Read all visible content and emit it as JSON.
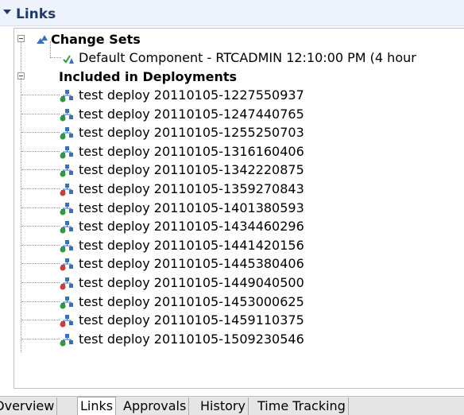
{
  "section": {
    "title": "Links"
  },
  "tree": {
    "change_sets": {
      "label": "Change Sets",
      "items": [
        "Default Component - RTCADMIN 12:10:00 PM (4 hour"
      ]
    },
    "deployments": {
      "label": "Included in Deployments",
      "items": [
        {
          "label": "test deploy 20110105-1227550937",
          "status": "ok"
        },
        {
          "label": "test deploy 20110105-1247440765",
          "status": "ok"
        },
        {
          "label": "test deploy 20110105-1255250703",
          "status": "ok"
        },
        {
          "label": "test deploy 20110105-1316160406",
          "status": "ok"
        },
        {
          "label": "test deploy 20110105-1342220875",
          "status": "ok"
        },
        {
          "label": "test deploy 20110105-1359270843",
          "status": "error"
        },
        {
          "label": "test deploy 20110105-1401380593",
          "status": "ok"
        },
        {
          "label": "test deploy 20110105-1434460296",
          "status": "ok"
        },
        {
          "label": "test deploy 20110105-1441420156",
          "status": "ok"
        },
        {
          "label": "test deploy 20110105-1445380406",
          "status": "error"
        },
        {
          "label": "test deploy 20110105-1449040500",
          "status": "error"
        },
        {
          "label": "test deploy 20110105-1453000625",
          "status": "ok"
        },
        {
          "label": "test deploy 20110105-1459110375",
          "status": "error"
        },
        {
          "label": "test deploy 20110105-1509230546",
          "status": "ok"
        }
      ]
    }
  },
  "tabs": [
    {
      "label": "Overview",
      "active": false
    },
    {
      "label": "Links",
      "active": true
    },
    {
      "label": "Approvals",
      "active": false
    },
    {
      "label": "History",
      "active": false
    },
    {
      "label": "Time Tracking",
      "active": false
    }
  ],
  "colors": {
    "ok": "#2e9a3c",
    "error": "#d23a3a",
    "node": "#3b6fb6"
  }
}
